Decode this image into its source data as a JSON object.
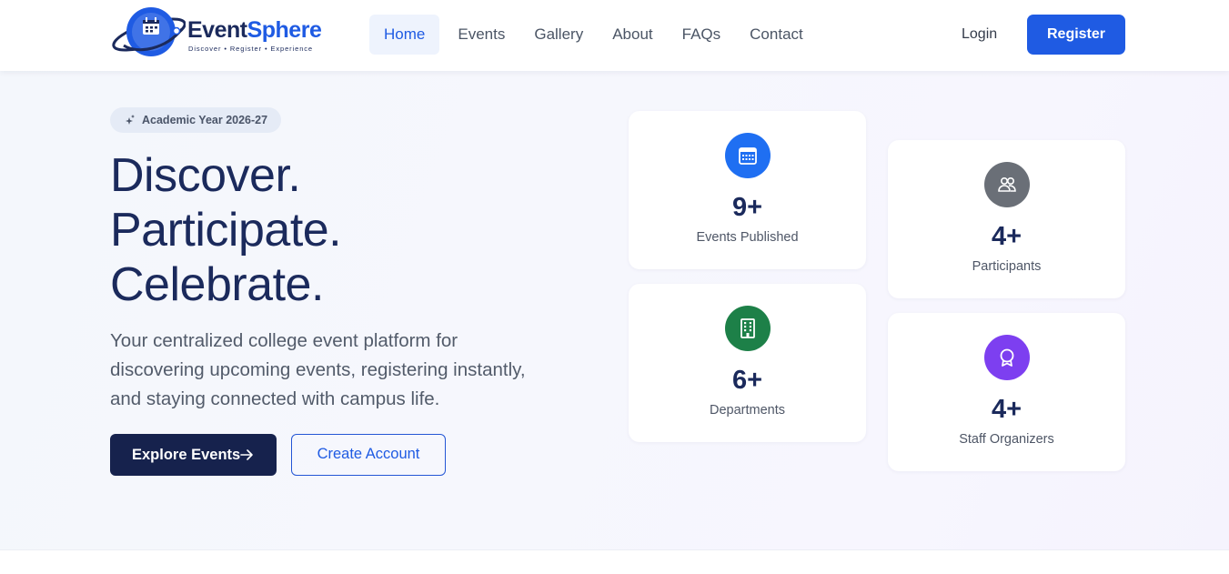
{
  "brand": {
    "name_part1": "Event",
    "name_part2": "Sphere",
    "tagline": "Discover • Register • Experience",
    "colors": {
      "navy": "#1b2a5c",
      "blue": "#1f5be3"
    }
  },
  "nav": {
    "links": [
      "Home",
      "Events",
      "Gallery",
      "About",
      "FAQs",
      "Contact"
    ],
    "active": "Home",
    "login_label": "Login",
    "register_label": "Register"
  },
  "hero": {
    "badge": "Academic Year 2026-27",
    "headline": [
      "Discover.",
      "Participate.",
      "Celebrate."
    ],
    "subtext": "Your centralized college event platform for discovering upcoming events, registering instantly, and staying connected with campus life.",
    "explore_label": "Explore Events",
    "create_label": "Create Account"
  },
  "stats": [
    {
      "value": "9+",
      "label": "Events Published",
      "icon": "calendar-icon",
      "color": "#1f6ff2"
    },
    {
      "value": "4+",
      "label": "Participants",
      "icon": "users-icon",
      "color": "#6a6f77"
    },
    {
      "value": "6+",
      "label": "Departments",
      "icon": "building-icon",
      "color": "#1d8048"
    },
    {
      "value": "4+",
      "label": "Staff Organizers",
      "icon": "award-icon",
      "color": "#7d3ff0"
    }
  ]
}
